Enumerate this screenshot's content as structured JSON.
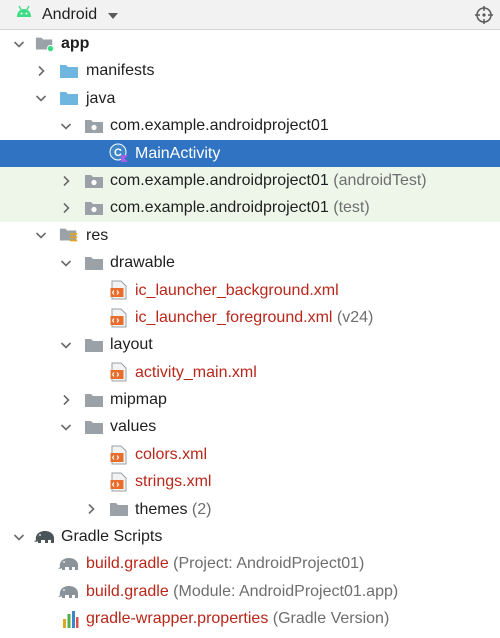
{
  "toolbar": {
    "view_mode": "Android",
    "icons": {
      "logo": "android-robot-icon",
      "dropdown": "chevron-down-icon",
      "locate": "crosshair-locate-icon"
    }
  },
  "tree": {
    "app": "app",
    "manifests": "manifests",
    "java": "java",
    "pkg_main": "com.example.androidproject01",
    "main_activity": "MainActivity",
    "pkg_android_test": "com.example.androidproject01",
    "pkg_android_test_suffix": " (androidTest)",
    "pkg_test": "com.example.androidproject01",
    "pkg_test_suffix": " (test)",
    "res": "res",
    "drawable": "drawable",
    "ic_bg": "ic_launcher_background.xml",
    "ic_fg": "ic_launcher_foreground.xml",
    "ic_fg_suffix": " (v24)",
    "layout": "layout",
    "activity_main": "activity_main.xml",
    "mipmap": "mipmap",
    "values": "values",
    "colors": "colors.xml",
    "strings": "strings.xml",
    "themes": "themes",
    "themes_suffix": " (2)",
    "gradle_scripts": "Gradle Scripts",
    "build_project": "build.gradle",
    "build_project_suffix": " (Project: AndroidProject01)",
    "build_module": "build.gradle",
    "build_module_suffix": " (Module: AndroidProject01.app)",
    "wrapper": "gradle-wrapper.properties",
    "wrapper_suffix": " (Gradle Version)"
  },
  "colors": {
    "selection": "#2f73c2",
    "test_tint": "#eef6ea",
    "resource_file_text": "#b8271a",
    "secondary_text": "#6e6e6e",
    "android_green": "#3ddc84",
    "source_folder_blue": "#6eb5e0"
  }
}
